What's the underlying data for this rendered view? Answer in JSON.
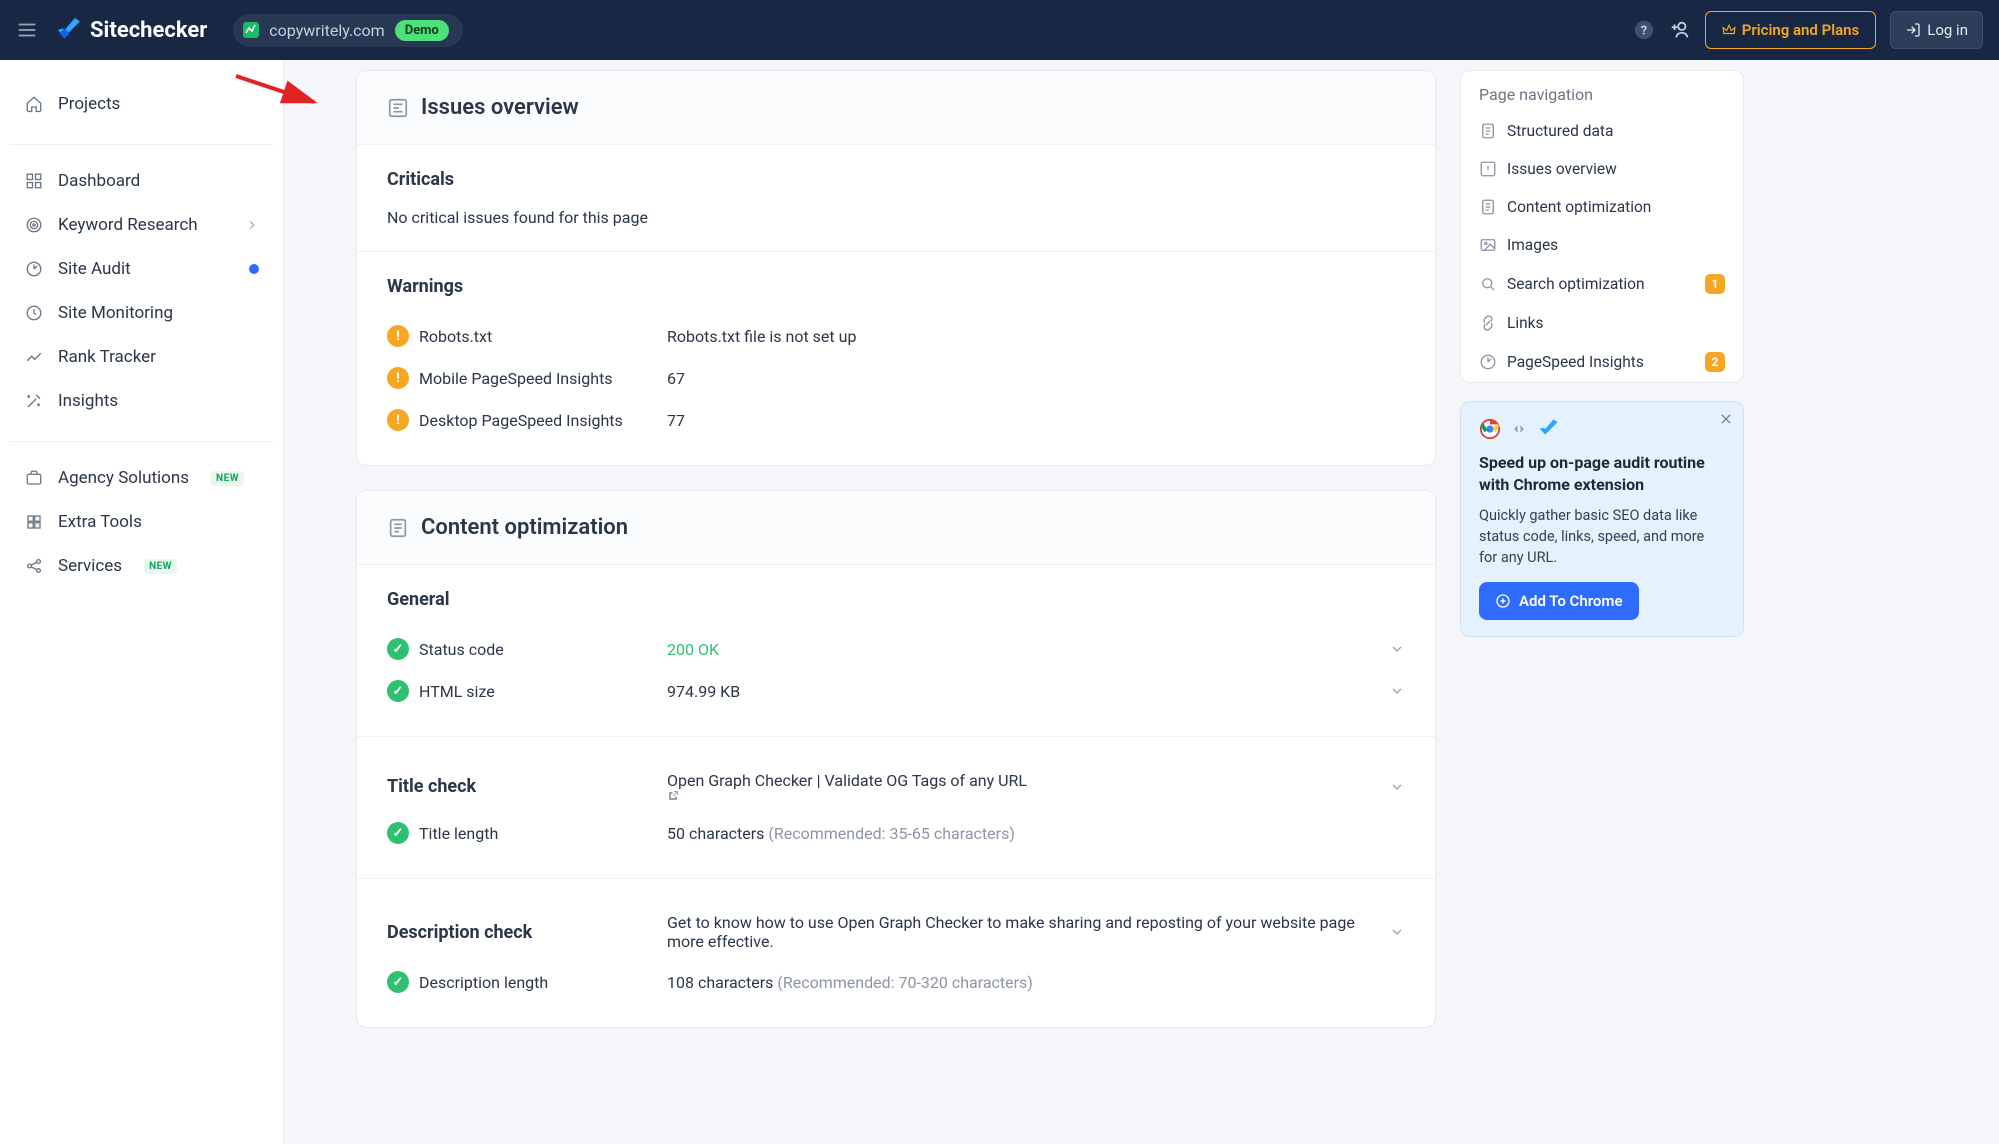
{
  "topbar": {
    "brand": "Sitechecker",
    "domain": "copywritely.com",
    "demo_label": "Demo",
    "pricing_label": "Pricing and Plans",
    "login_label": "Log in"
  },
  "sidebar": {
    "group1": [
      {
        "label": "Projects",
        "icon": "home"
      }
    ],
    "group2": [
      {
        "label": "Dashboard",
        "icon": "grid"
      },
      {
        "label": "Keyword Research",
        "icon": "target",
        "chevron": true
      },
      {
        "label": "Site Audit",
        "icon": "gauge",
        "dot": true
      },
      {
        "label": "Site Monitoring",
        "icon": "clock"
      },
      {
        "label": "Rank Tracker",
        "icon": "trend"
      },
      {
        "label": "Insights",
        "icon": "wand"
      }
    ],
    "group3": [
      {
        "label": "Agency Solutions",
        "icon": "briefcase",
        "new": "NEW"
      },
      {
        "label": "Extra Tools",
        "icon": "puzzle"
      },
      {
        "label": "Services",
        "icon": "share",
        "new": "NEW"
      }
    ]
  },
  "issues": {
    "title": "Issues overview",
    "criticals_label": "Criticals",
    "criticals_text": "No critical issues found for this page",
    "warnings_label": "Warnings",
    "warnings": [
      {
        "label": "Robots.txt",
        "value": "Robots.txt file is not set up"
      },
      {
        "label": "Mobile PageSpeed Insights",
        "value": "67"
      },
      {
        "label": "Desktop PageSpeed Insights",
        "value": "77"
      }
    ]
  },
  "content": {
    "title": "Content optimization",
    "general_label": "General",
    "general": [
      {
        "label": "Status code",
        "value": "200 OK",
        "ok": true
      },
      {
        "label": "HTML size",
        "value": "974.99 KB"
      }
    ],
    "title_check_label": "Title check",
    "title_check_value": "Open Graph Checker | Validate OG Tags of any URL",
    "title_length_label": "Title length",
    "title_length_value": "50 characters",
    "title_length_hint": "(Recommended: 35-65 characters)",
    "desc_check_label": "Description check",
    "desc_check_value": "Get to know how to use Open Graph Checker to make sharing and reposting of your website page more effective.",
    "desc_length_label": "Description length",
    "desc_length_value": "108 characters",
    "desc_length_hint": "(Recommended: 70-320 characters)"
  },
  "pagenav": {
    "title": "Page navigation",
    "items": [
      {
        "label": "Structured data",
        "icon": "doc"
      },
      {
        "label": "Issues overview",
        "icon": "warn"
      },
      {
        "label": "Content optimization",
        "icon": "doc"
      },
      {
        "label": "Images",
        "icon": "image"
      },
      {
        "label": "Search optimization",
        "icon": "search",
        "badge": "1"
      },
      {
        "label": "Links",
        "icon": "link"
      },
      {
        "label": "PageSpeed Insights",
        "icon": "gauge",
        "badge": "2"
      }
    ]
  },
  "promo": {
    "title": "Speed up on-page audit routine with Chrome extension",
    "text": "Quickly gather basic SEO data like status code, links, speed, and more for any URL.",
    "cta": "Add To Chrome"
  }
}
